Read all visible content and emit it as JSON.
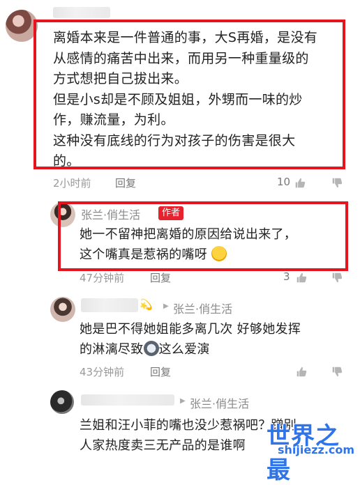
{
  "comment": {
    "lines": [
      "离婚本来是一件普通的事，大S再婚，是没有",
      "从感情的痛苦中出来，而用另一种重量级的",
      "方式想把自己拔出来。",
      "但是小s却是不顾及姐姐，外甥而一味的炒",
      "作，赚流量，为利。",
      "这种没有底线的行为对孩子的伤害是很大",
      "的。"
    ],
    "time": "2小时前",
    "reply_label": "回复",
    "likes": "10"
  },
  "replies": [
    {
      "name": "张兰·俏生活",
      "badge": "作者",
      "lines": [
        "她一不留神把离婚的原因给说出来了，",
        "这个嘴真是惹祸的嘴呀"
      ],
      "emoji": "laughing-crying-emoji",
      "time": "47分钟前",
      "reply_label": "回复",
      "likes": "3"
    },
    {
      "reply_to": "张兰·俏生活",
      "lines": [
        "她是巴不得她姐能多离几次 好够她发挥",
        "的淋漓尽致",
        "这么爱演"
      ],
      "emoji": "husky-emoji",
      "time": "43分钟前",
      "reply_label": "回复"
    },
    {
      "reply_to": "张兰·俏生活",
      "lines": [
        "兰姐和汪小菲的嘴也没少惹祸吧？蹭别",
        "人家热度卖三无产品的是谁啊"
      ]
    }
  ],
  "watermark": {
    "title": "世界之最",
    "url": "shijiezz.com"
  },
  "colors": {
    "highlight_border": "#e5141e",
    "badge": "#e5222d",
    "watermark": "#2f74e8"
  },
  "icons": [
    "thumb-up-icon",
    "thumb-down-icon"
  ]
}
